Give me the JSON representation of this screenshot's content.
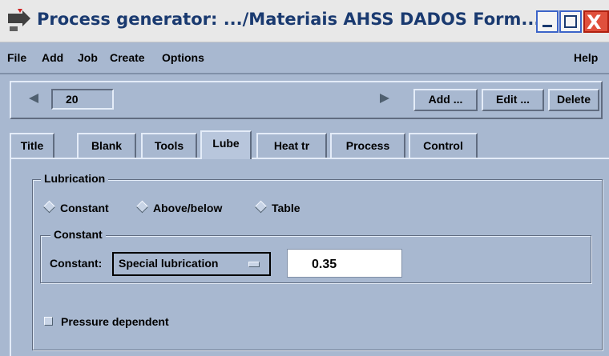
{
  "window": {
    "title": "Process generator: .../Materiais AHSS DADOS Form...",
    "app_icon": "process-generator-icon",
    "controls": [
      "minimize-icon",
      "maximize-icon",
      "close-icon"
    ],
    "close_glyph": "X"
  },
  "menubar": {
    "items": [
      "File",
      "Add",
      "Job",
      "Create",
      "Options"
    ],
    "help": "Help"
  },
  "navigator": {
    "current": "20",
    "add_label": "Add ...",
    "edit_label": "Edit ...",
    "delete_label": "Delete"
  },
  "tabs": {
    "items": [
      "Title",
      "Blank",
      "Tools",
      "Lube",
      "Heat tr",
      "Process",
      "Control"
    ],
    "active": "Lube"
  },
  "lubrication": {
    "group_label": "Lubrication",
    "options": [
      "Constant",
      "Above/below",
      "Table"
    ],
    "selected": "Constant",
    "constant_group_label": "Constant",
    "constant_label": "Constant:",
    "type_value": "Special lubrication",
    "coefficient": "0.35",
    "pressure_dependent_label": "Pressure dependent",
    "pressure_dependent_checked": false
  },
  "colors": {
    "background": "#a8b8d0",
    "title_text": "#1a3a70",
    "close_button": "#e0503c"
  }
}
